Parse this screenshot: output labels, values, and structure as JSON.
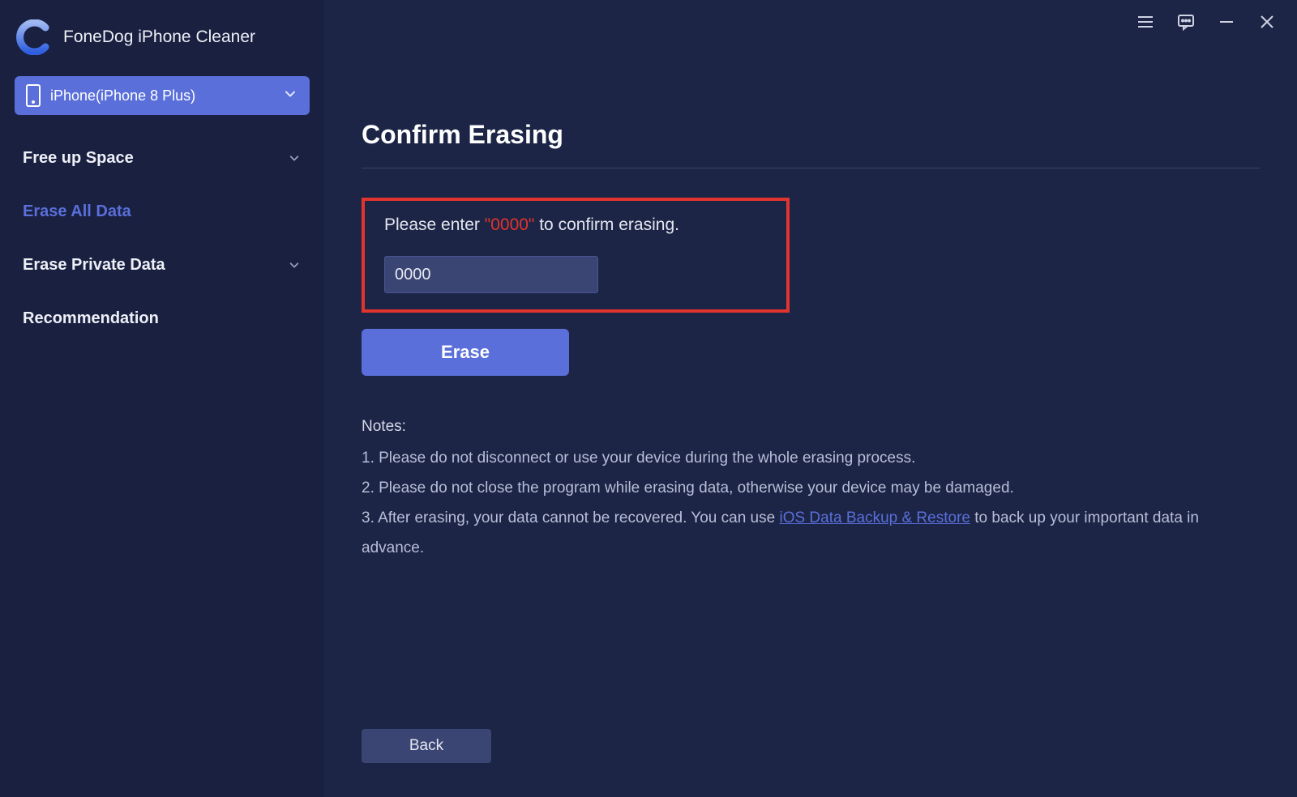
{
  "brand": {
    "title": "FoneDog iPhone Cleaner"
  },
  "device": {
    "label": "iPhone(iPhone 8 Plus)"
  },
  "sidebar": {
    "items": [
      {
        "label": "Free up Space",
        "expandable": true,
        "active": false
      },
      {
        "label": "Erase All Data",
        "expandable": false,
        "active": true
      },
      {
        "label": "Erase Private Data",
        "expandable": true,
        "active": false
      },
      {
        "label": "Recommendation",
        "expandable": false,
        "active": false
      }
    ]
  },
  "main": {
    "title": "Confirm Erasing",
    "prompt_pre": "Please enter ",
    "prompt_code": "\"0000\"",
    "prompt_post": " to confirm erasing.",
    "input_value": "0000",
    "erase_label": "Erase",
    "notes_title": "Notes:",
    "note1": "1. Please do not disconnect or use your device during the whole erasing process.",
    "note2": "2. Please do not close the program while erasing data, otherwise your device may be damaged.",
    "note3_pre": "3. After erasing, your data cannot be recovered. You can use ",
    "note3_link": "iOS Data Backup & Restore",
    "note3_post": " to back up your important data in advance.",
    "back_label": "Back"
  }
}
